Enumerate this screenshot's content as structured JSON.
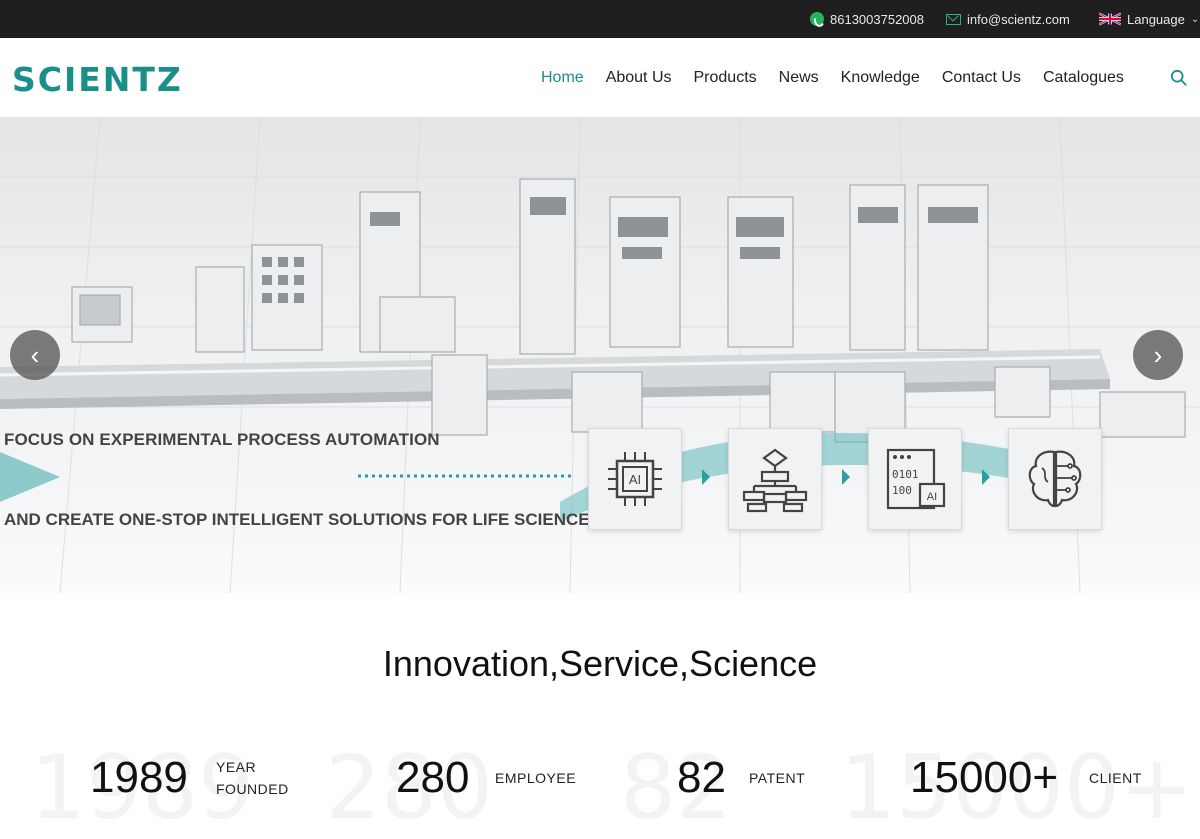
{
  "topbar": {
    "phone": "8613003752008",
    "email": "info@scientz.com",
    "language": "Language"
  },
  "header": {
    "logo": "SCIENTZ",
    "nav": [
      {
        "label": "Home",
        "active": true
      },
      {
        "label": "About Us"
      },
      {
        "label": "Products"
      },
      {
        "label": "News"
      },
      {
        "label": "Knowledge"
      },
      {
        "label": "Contact Us"
      },
      {
        "label": "Catalogues"
      }
    ]
  },
  "hero": {
    "line1": "FOCUS ON EXPERIMENTAL PROCESS AUTOMATION",
    "line2": "AND CREATE ONE-STOP INTELLIGENT SOLUTIONS FOR LIFE SCIENCES",
    "chip_label": "AI",
    "code_label": "AI",
    "prev_arrow": "‹",
    "next_arrow": "›"
  },
  "tagline": "Innovation,Service,Science",
  "stats": [
    {
      "value": "1989",
      "label": "YEAR FOUNDED",
      "label_line1": "YEAR",
      "label_line2": "FOUNDED"
    },
    {
      "value": "280",
      "label": "EMPLOYEE"
    },
    {
      "value": "82",
      "label": "PATENT"
    },
    {
      "value": "15000+",
      "label": "CLIENT"
    }
  ],
  "colors": {
    "brand": "#1a8f8a",
    "topbar": "#1f1f1f",
    "accent_teal": "#5fb8bb"
  }
}
